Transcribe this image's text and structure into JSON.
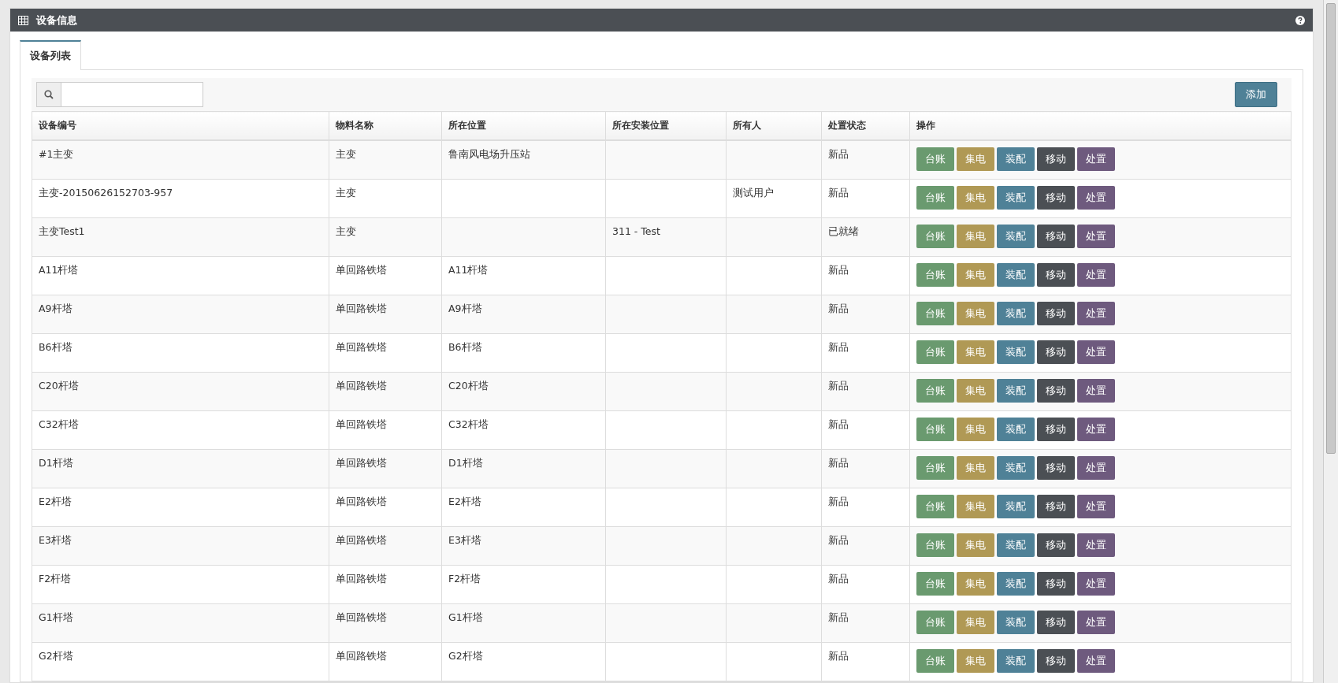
{
  "panel": {
    "title": "设备信息"
  },
  "tabs": [
    {
      "label": "设备列表",
      "selected": true
    }
  ],
  "add_button": "添加",
  "table": {
    "columns": [
      "设备编号",
      "物料名称",
      "所在位置",
      "所在安装位置",
      "所有人",
      "处置状态",
      "操作"
    ],
    "rows": [
      {
        "cells": [
          "#1主变",
          "主变",
          "鲁南风电场升压站",
          "",
          "",
          "新品"
        ],
        "actions": [
          {
            "label": "台账",
            "kind": "ledger"
          },
          {
            "label": "集电",
            "kind": "collect"
          },
          {
            "label": "装配",
            "kind": "assemble"
          },
          {
            "label": "移动",
            "kind": "move"
          },
          {
            "label": "处置",
            "kind": "dispose"
          }
        ]
      },
      {
        "cells": [
          "主变-20150626152703-957",
          "主变",
          "",
          "",
          "测试用户",
          "新品"
        ],
        "actions": [
          {
            "label": "台账",
            "kind": "ledger"
          },
          {
            "label": "集电",
            "kind": "collect"
          },
          {
            "label": "装配",
            "kind": "assemble"
          },
          {
            "label": "移动",
            "kind": "move"
          },
          {
            "label": "处置",
            "kind": "dispose"
          }
        ]
      },
      {
        "cells": [
          "主变Test1",
          "主变",
          "",
          "311 - Test",
          "",
          "已就绪"
        ],
        "actions": [
          {
            "label": "台账",
            "kind": "ledger"
          },
          {
            "label": "集电",
            "kind": "collect"
          },
          {
            "label": "装配",
            "kind": "assemble"
          },
          {
            "label": "移动",
            "kind": "move"
          },
          {
            "label": "处置",
            "kind": "dispose"
          }
        ]
      },
      {
        "cells": [
          "A11杆塔",
          "单回路铁塔",
          "A11杆塔",
          "",
          "",
          "新品"
        ],
        "actions": [
          {
            "label": "台账",
            "kind": "ledger"
          },
          {
            "label": "集电",
            "kind": "collect"
          },
          {
            "label": "装配",
            "kind": "assemble"
          },
          {
            "label": "移动",
            "kind": "move"
          },
          {
            "label": "处置",
            "kind": "dispose"
          }
        ]
      },
      {
        "cells": [
          "A9杆塔",
          "单回路铁塔",
          "A9杆塔",
          "",
          "",
          "新品"
        ],
        "actions": [
          {
            "label": "台账",
            "kind": "ledger"
          },
          {
            "label": "集电",
            "kind": "collect"
          },
          {
            "label": "装配",
            "kind": "assemble"
          },
          {
            "label": "移动",
            "kind": "move"
          },
          {
            "label": "处置",
            "kind": "dispose"
          }
        ]
      },
      {
        "cells": [
          "B6杆塔",
          "单回路铁塔",
          "B6杆塔",
          "",
          "",
          "新品"
        ],
        "actions": [
          {
            "label": "台账",
            "kind": "ledger"
          },
          {
            "label": "集电",
            "kind": "collect"
          },
          {
            "label": "装配",
            "kind": "assemble"
          },
          {
            "label": "移动",
            "kind": "move"
          },
          {
            "label": "处置",
            "kind": "dispose"
          }
        ]
      },
      {
        "cells": [
          "C20杆塔",
          "单回路铁塔",
          "C20杆塔",
          "",
          "",
          "新品"
        ],
        "actions": [
          {
            "label": "台账",
            "kind": "ledger"
          },
          {
            "label": "集电",
            "kind": "collect"
          },
          {
            "label": "装配",
            "kind": "assemble"
          },
          {
            "label": "移动",
            "kind": "move"
          },
          {
            "label": "处置",
            "kind": "dispose"
          }
        ]
      },
      {
        "cells": [
          "C32杆塔",
          "单回路铁塔",
          "C32杆塔",
          "",
          "",
          "新品"
        ],
        "actions": [
          {
            "label": "台账",
            "kind": "ledger"
          },
          {
            "label": "集电",
            "kind": "collect"
          },
          {
            "label": "装配",
            "kind": "assemble"
          },
          {
            "label": "移动",
            "kind": "move"
          },
          {
            "label": "处置",
            "kind": "dispose"
          }
        ]
      },
      {
        "cells": [
          "D1杆塔",
          "单回路铁塔",
          "D1杆塔",
          "",
          "",
          "新品"
        ],
        "actions": [
          {
            "label": "台账",
            "kind": "ledger"
          },
          {
            "label": "集电",
            "kind": "collect"
          },
          {
            "label": "装配",
            "kind": "assemble"
          },
          {
            "label": "移动",
            "kind": "move"
          },
          {
            "label": "处置",
            "kind": "dispose"
          }
        ]
      },
      {
        "cells": [
          "E2杆塔",
          "单回路铁塔",
          "E2杆塔",
          "",
          "",
          "新品"
        ],
        "actions": [
          {
            "label": "台账",
            "kind": "ledger"
          },
          {
            "label": "集电",
            "kind": "collect"
          },
          {
            "label": "装配",
            "kind": "assemble"
          },
          {
            "label": "移动",
            "kind": "move"
          },
          {
            "label": "处置",
            "kind": "dispose"
          }
        ]
      },
      {
        "cells": [
          "E3杆塔",
          "单回路铁塔",
          "E3杆塔",
          "",
          "",
          "新品"
        ],
        "actions": [
          {
            "label": "台账",
            "kind": "ledger"
          },
          {
            "label": "集电",
            "kind": "collect"
          },
          {
            "label": "装配",
            "kind": "assemble"
          },
          {
            "label": "移动",
            "kind": "move"
          },
          {
            "label": "处置",
            "kind": "dispose"
          }
        ]
      },
      {
        "cells": [
          "F2杆塔",
          "单回路铁塔",
          "F2杆塔",
          "",
          "",
          "新品"
        ],
        "actions": [
          {
            "label": "台账",
            "kind": "ledger"
          },
          {
            "label": "集电",
            "kind": "collect"
          },
          {
            "label": "装配",
            "kind": "assemble"
          },
          {
            "label": "移动",
            "kind": "move"
          },
          {
            "label": "处置",
            "kind": "dispose"
          }
        ]
      },
      {
        "cells": [
          "G1杆塔",
          "单回路铁塔",
          "G1杆塔",
          "",
          "",
          "新品"
        ],
        "actions": [
          {
            "label": "台账",
            "kind": "ledger"
          },
          {
            "label": "集电",
            "kind": "collect"
          },
          {
            "label": "装配",
            "kind": "assemble"
          },
          {
            "label": "移动",
            "kind": "move"
          },
          {
            "label": "处置",
            "kind": "dispose"
          }
        ]
      },
      {
        "cells": [
          "G2杆塔",
          "单回路铁塔",
          "G2杆塔",
          "",
          "",
          "新品"
        ],
        "actions": [
          {
            "label": "台账",
            "kind": "ledger"
          },
          {
            "label": "集电",
            "kind": "collect"
          },
          {
            "label": "装配",
            "kind": "assemble"
          },
          {
            "label": "移动",
            "kind": "move"
          },
          {
            "label": "处置",
            "kind": "dispose"
          }
        ]
      }
    ]
  }
}
